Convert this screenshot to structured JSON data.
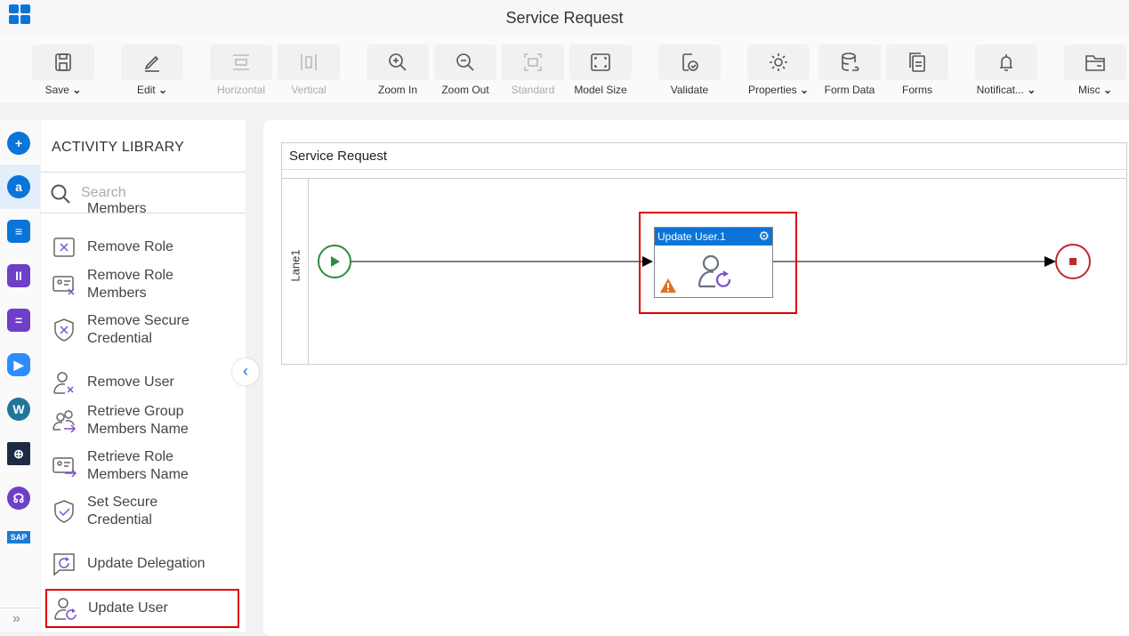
{
  "app": {
    "title": "Service Request"
  },
  "toolbar": [
    {
      "label": "Save",
      "icon": "save-icon",
      "dropdown": true,
      "enabled": true
    },
    {
      "label": "Edit",
      "icon": "pencil-icon",
      "dropdown": true,
      "enabled": true
    },
    {
      "label": "Horizontal",
      "icon": "horizontal-icon",
      "enabled": false
    },
    {
      "label": "Vertical",
      "icon": "vertical-icon",
      "enabled": false
    },
    {
      "label": "Zoom In",
      "icon": "zoom-in-icon",
      "enabled": true
    },
    {
      "label": "Zoom Out",
      "icon": "zoom-out-icon",
      "enabled": true
    },
    {
      "label": "Standard",
      "icon": "standard-icon",
      "enabled": false
    },
    {
      "label": "Model Size",
      "icon": "model-size-icon",
      "enabled": true
    },
    {
      "label": "Validate",
      "icon": "validate-icon",
      "enabled": true
    },
    {
      "label": "Properties",
      "icon": "gear-icon",
      "dropdown": true,
      "enabled": true
    },
    {
      "label": "Form Data",
      "icon": "database-icon",
      "enabled": true
    },
    {
      "label": "Forms",
      "icon": "forms-icon",
      "enabled": true
    },
    {
      "label": "Notificat...",
      "icon": "bell-icon",
      "dropdown": true,
      "enabled": true
    },
    {
      "label": "Misc",
      "icon": "folder-icon",
      "dropdown": true,
      "enabled": true
    }
  ],
  "library": {
    "title": "ACTIVITY LIBRARY",
    "search_placeholder": "Search",
    "partial_item": "Members",
    "items": [
      {
        "label": "Remove Role",
        "icon": "remove-role-icon"
      },
      {
        "label": "Remove Role Members",
        "icon": "remove-role-members-icon"
      },
      {
        "label": "Remove Secure Credential",
        "icon": "remove-credential-icon"
      },
      {
        "label": "Remove User",
        "icon": "remove-user-icon"
      },
      {
        "label": "Retrieve Group Members Name",
        "icon": "retrieve-group-icon"
      },
      {
        "label": "Retrieve Role Members Name",
        "icon": "retrieve-role-icon"
      },
      {
        "label": "Set Secure Credential",
        "icon": "set-credential-icon"
      },
      {
        "label": "Update Delegation",
        "icon": "update-delegation-icon"
      },
      {
        "label": "Update User",
        "icon": "update-user-icon",
        "highlighted": true
      }
    ]
  },
  "diagram": {
    "pool_title": "Service Request",
    "lane_label": "Lane1",
    "task": {
      "label": "Update User.1",
      "warning": true
    }
  },
  "colors": {
    "accent": "#0a74d8",
    "highlight": "#e00000",
    "start": "#2e8b3e",
    "end": "#c0272d",
    "warning": "#e07020",
    "purple": "#7b4fd0"
  }
}
